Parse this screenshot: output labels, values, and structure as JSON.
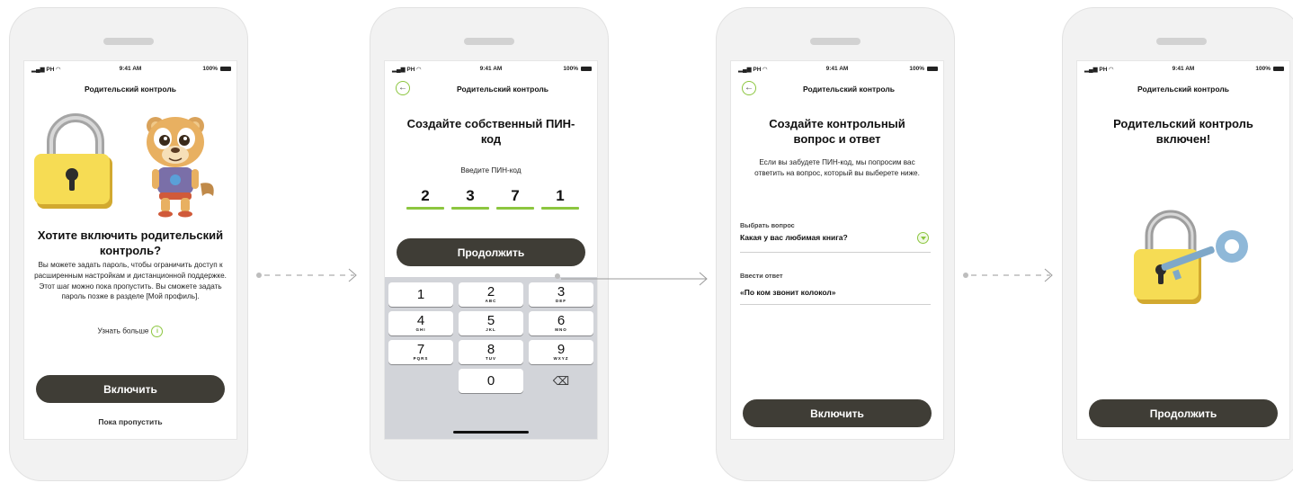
{
  "status_bar": {
    "carrier": "PH",
    "time": "9:41 AM",
    "battery": "100%"
  },
  "header_title": "Родительский контроль",
  "screen1": {
    "title": "Хотите включить родительский контроль?",
    "body": "Вы можете задать пароль, чтобы ограничить доступ к расширенным настройкам и дистанционной поддержке. Этот шаг можно пока пропустить. Вы сможете задать пароль позже в разделе [Мой профиль].",
    "learn_more": "Узнать больше",
    "enable_button": "Включить",
    "skip_link": "Пока пропустить"
  },
  "screen2": {
    "title": "Создайте собственный ПИН-код",
    "prompt": "Введите ПИН-код",
    "pin_digits": [
      "2",
      "3",
      "7",
      "1"
    ],
    "continue_button": "Продолжить",
    "keypad": [
      {
        "num": "1",
        "letters": ""
      },
      {
        "num": "2",
        "letters": "ABC"
      },
      {
        "num": "3",
        "letters": "DEF"
      },
      {
        "num": "4",
        "letters": "GHI"
      },
      {
        "num": "5",
        "letters": "JKL"
      },
      {
        "num": "6",
        "letters": "MNO"
      },
      {
        "num": "7",
        "letters": "PQRS"
      },
      {
        "num": "8",
        "letters": "TUV"
      },
      {
        "num": "9",
        "letters": "WXYZ"
      },
      {
        "num": "0",
        "letters": ""
      }
    ]
  },
  "screen3": {
    "title": "Создайте контрольный вопрос и ответ",
    "body": "Если вы забудете ПИН-код, мы попросим вас ответить на вопрос, который вы выберете ниже.",
    "question_label": "Выбрать вопрос",
    "question_value": "Какая у вас любимая книга?",
    "answer_label": "Ввести ответ",
    "answer_value": "«По ком звонит колокол»",
    "enable_button": "Включить"
  },
  "screen4": {
    "title": "Родительский контроль включен!",
    "continue_button": "Продолжить"
  },
  "colors": {
    "accent_green": "#8cc63f",
    "button_dark": "#3f3d36",
    "lock_yellow": "#f6dc54",
    "lock_shackle": "#9e9e9e",
    "key_blue": "#8fb8d8"
  },
  "icons": [
    "back-arrow-icon",
    "info-icon",
    "dropdown-icon",
    "backspace-icon",
    "lock-icon",
    "key-icon",
    "lion-mascot"
  ]
}
